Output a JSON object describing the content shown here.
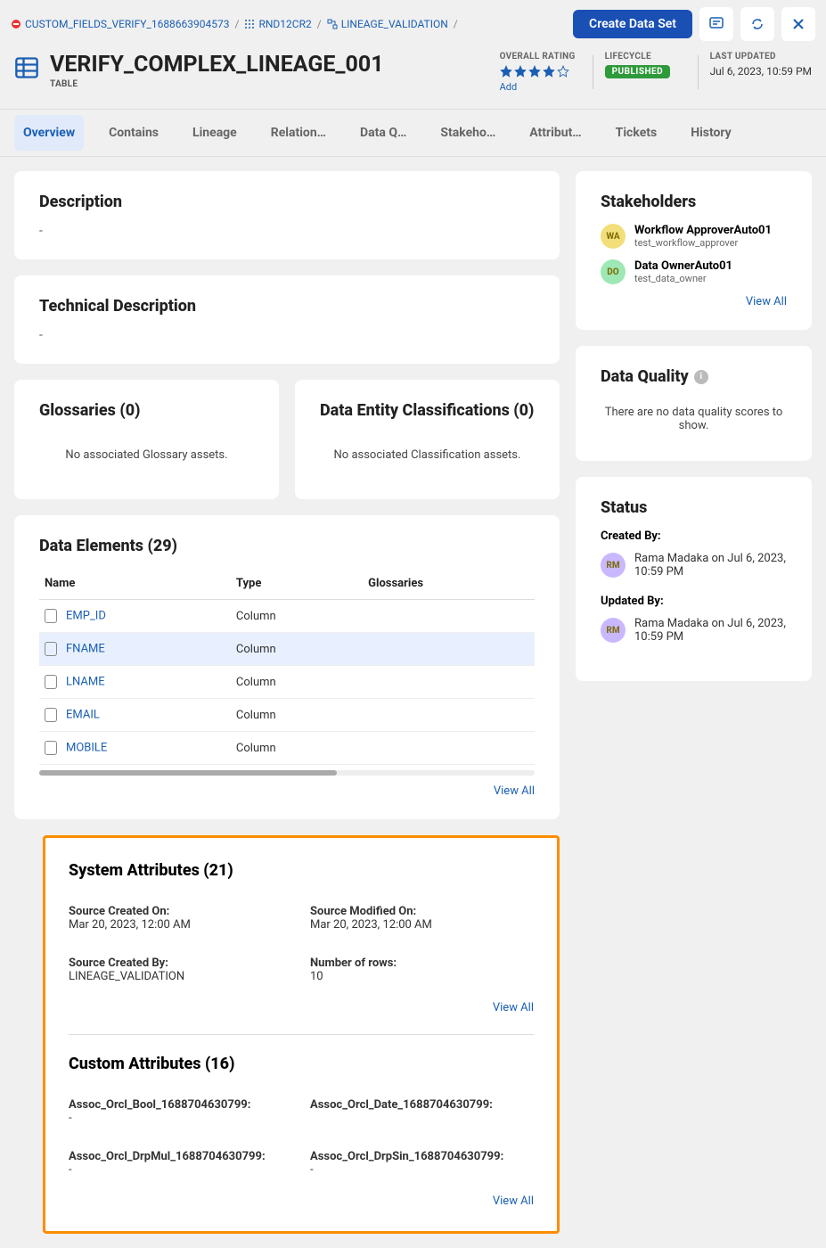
{
  "breadcrumbs": [
    {
      "label": "CUSTOM_FIELDS_VERIFY_1688663904573"
    },
    {
      "label": "RND12CR2"
    },
    {
      "label": "LINEAGE_VALIDATION"
    }
  ],
  "actions": {
    "create_data_set": "Create Data Set"
  },
  "title": "VERIFY_COMPLEX_LINEAGE_001",
  "subtitle": "TABLE",
  "meta": {
    "overall_rating_label": "OVERALL RATING",
    "rating_stars": 4,
    "add_label": "Add",
    "lifecycle_label": "LIFECYCLE",
    "lifecycle_value": "PUBLISHED",
    "last_updated_label": "LAST UPDATED",
    "last_updated_value": "Jul 6, 2023, 10:59 PM"
  },
  "tabs": [
    "Overview",
    "Contains",
    "Lineage",
    "Relation…",
    "Data Q…",
    "Stakeho…",
    "Attribut…",
    "Tickets",
    "History"
  ],
  "active_tab": 0,
  "description": {
    "title": "Description",
    "body": "-"
  },
  "tech_description": {
    "title": "Technical Description",
    "body": "-"
  },
  "glossaries": {
    "title": "Glossaries (0)",
    "msg": "No associated Glossary assets."
  },
  "classifications": {
    "title": "Data Entity Classifications (0)",
    "msg": "No associated Classification assets."
  },
  "data_elements": {
    "title": "Data Elements (29)",
    "columns": [
      "Name",
      "Type",
      "Glossaries"
    ],
    "rows": [
      {
        "name": "EMP_ID",
        "type": "Column",
        "highlight": false
      },
      {
        "name": "FNAME",
        "type": "Column",
        "highlight": true
      },
      {
        "name": "LNAME",
        "type": "Column",
        "highlight": false
      },
      {
        "name": "EMAIL",
        "type": "Column",
        "highlight": false
      },
      {
        "name": "MOBILE",
        "type": "Column",
        "highlight": false
      }
    ],
    "viewall": "View All"
  },
  "system_attributes": {
    "title": "System Attributes (21)",
    "rows": [
      {
        "label": "Source Created On:",
        "value": "Mar 20, 2023, 12:00 AM"
      },
      {
        "label": "Source Modified On:",
        "value": "Mar 20, 2023, 12:00 AM"
      },
      {
        "label": "Source Created By:",
        "value": "LINEAGE_VALIDATION"
      },
      {
        "label": "Number of rows:",
        "value": "10"
      }
    ],
    "viewall": "View All"
  },
  "custom_attributes": {
    "title": "Custom Attributes (16)",
    "rows": [
      {
        "label": "Assoc_Orcl_Bool_1688704630799:",
        "value": "-"
      },
      {
        "label": "Assoc_Orcl_Date_1688704630799:",
        "value": ""
      },
      {
        "label": "Assoc_Orcl_DrpMul_1688704630799:",
        "value": "-"
      },
      {
        "label": "Assoc_Orcl_DrpSin_1688704630799:",
        "value": "-"
      }
    ],
    "viewall": "View All"
  },
  "stakeholders": {
    "title": "Stakeholders",
    "items": [
      {
        "initials": "WA",
        "cls": "av-wa",
        "name": "Workflow ApproverAuto01",
        "role": "test_workflow_approver"
      },
      {
        "initials": "DO",
        "cls": "av-do",
        "name": "Data OwnerAuto01",
        "role": "test_data_owner"
      }
    ],
    "viewall": "View All"
  },
  "data_quality": {
    "title": "Data Quality",
    "msg": "There are no data quality scores to show."
  },
  "status": {
    "title": "Status",
    "created_by_label": "Created By:",
    "created_by": "Rama Madaka on Jul 6, 2023, 10:59 PM",
    "updated_by_label": "Updated By:",
    "updated_by": "Rama Madaka on Jul 6, 2023, 10:59 PM",
    "avatar": "RM"
  }
}
